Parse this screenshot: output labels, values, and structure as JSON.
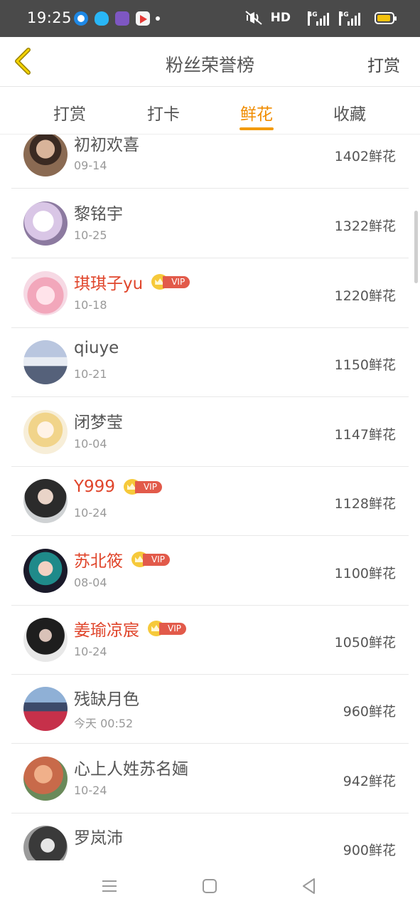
{
  "status_bar": {
    "time": "19:25",
    "hd": "HD",
    "net_tag": "4G"
  },
  "header": {
    "title": "粉丝荣誉榜",
    "action": "打赏",
    "back_icon": "chevron-left-icon"
  },
  "tabs": [
    {
      "label": "打赏",
      "active": false
    },
    {
      "label": "打卡",
      "active": false
    },
    {
      "label": "鲜花",
      "active": true
    },
    {
      "label": "收藏",
      "active": false
    }
  ],
  "vip_label": "VIP",
  "rows": [
    {
      "name": "初初欢喜",
      "date": "09-14",
      "count": "1402鲜花",
      "vip": false
    },
    {
      "name": "黎铭宇",
      "date": "10-25",
      "count": "1322鲜花",
      "vip": false
    },
    {
      "name": "琪琪子yu",
      "date": "10-18",
      "count": "1220鲜花",
      "vip": true
    },
    {
      "name": "qiuye",
      "date": "10-21",
      "count": "1150鲜花",
      "vip": false
    },
    {
      "name": "闭梦莹",
      "date": "10-04",
      "count": "1147鲜花",
      "vip": false
    },
    {
      "name": "Y999",
      "date": "10-24",
      "count": "1128鲜花",
      "vip": true
    },
    {
      "name": "苏北筱",
      "date": "08-04",
      "count": "1100鲜花",
      "vip": true
    },
    {
      "name": "姜瑜凉宸",
      "date": "10-24",
      "count": "1050鲜花",
      "vip": true
    },
    {
      "name": "残缺月色",
      "date": "今天 00:52",
      "count": "960鲜花",
      "vip": false
    },
    {
      "name": "心上人姓苏名婳",
      "date": "10-24",
      "count": "942鲜花",
      "vip": false
    },
    {
      "name": "罗岚沛",
      "date": "",
      "count": "900鲜花",
      "vip": false
    }
  ],
  "colors": {
    "accent": "#f08c00",
    "vip_name": "#e0452b",
    "status_bar": "#4a4a4a"
  }
}
